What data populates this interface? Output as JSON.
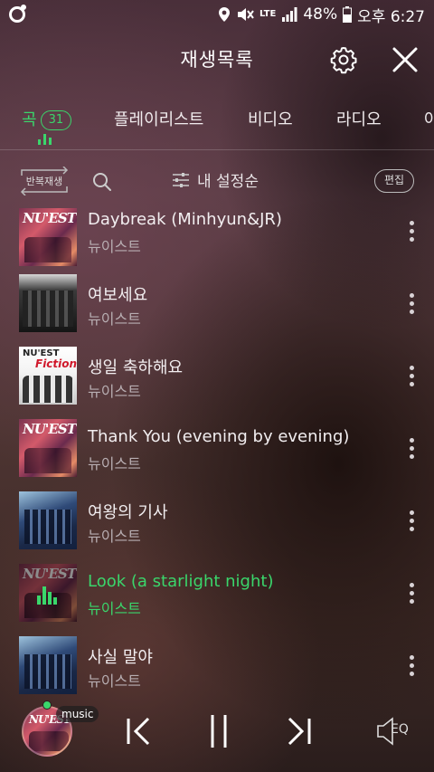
{
  "status_bar": {
    "battery": "48%",
    "time": "오후 6:27",
    "network": "LTE",
    "icons": [
      "app-icon",
      "location-icon",
      "mute-icon",
      "signal-icon",
      "battery-icon"
    ]
  },
  "header": {
    "title": "재생목록",
    "icons": [
      "gear-icon",
      "close-icon"
    ]
  },
  "tabs": [
    {
      "label": "곡",
      "count": "31",
      "active": true
    },
    {
      "label": "플레이리스트",
      "active": false
    },
    {
      "label": "비디오",
      "active": false
    },
    {
      "label": "라디오",
      "active": false
    },
    {
      "label": "아",
      "active": false
    }
  ],
  "toolbar": {
    "repeat_label": "반복재생",
    "sort_label": "내 설정순",
    "edit_label": "편집"
  },
  "songs": [
    {
      "title": "Daybreak (Minhyun&JR)",
      "artist": "뉴이스트",
      "art": "nuest",
      "art_text": "NU'EST",
      "playing": false
    },
    {
      "title": "여보세요",
      "artist": "뉴이스트",
      "art": "group",
      "playing": false
    },
    {
      "title": "생일 축하해요",
      "artist": "뉴이스트",
      "art": "fiction",
      "art_text": "NU'EST",
      "art_text2": "Fiction",
      "playing": false
    },
    {
      "title": "Thank You (evening by evening)",
      "artist": "뉴이스트",
      "art": "nuest",
      "art_text": "NU'EST",
      "playing": false
    },
    {
      "title": "여왕의 기사",
      "artist": "뉴이스트",
      "art": "queen",
      "playing": false
    },
    {
      "title": "Look (a starlight night)",
      "artist": "뉴이스트",
      "art": "nuest",
      "art_text": "NU'EST",
      "playing": true
    },
    {
      "title": "사실 말야",
      "artist": "뉴이스트",
      "art": "queen",
      "playing": false
    }
  ],
  "player": {
    "tag": "music",
    "eq_label": "EQ",
    "disc_text": "NU'EST",
    "state": "playing"
  },
  "colors": {
    "accent": "#3ad66b",
    "background": "#4a2f3a"
  }
}
